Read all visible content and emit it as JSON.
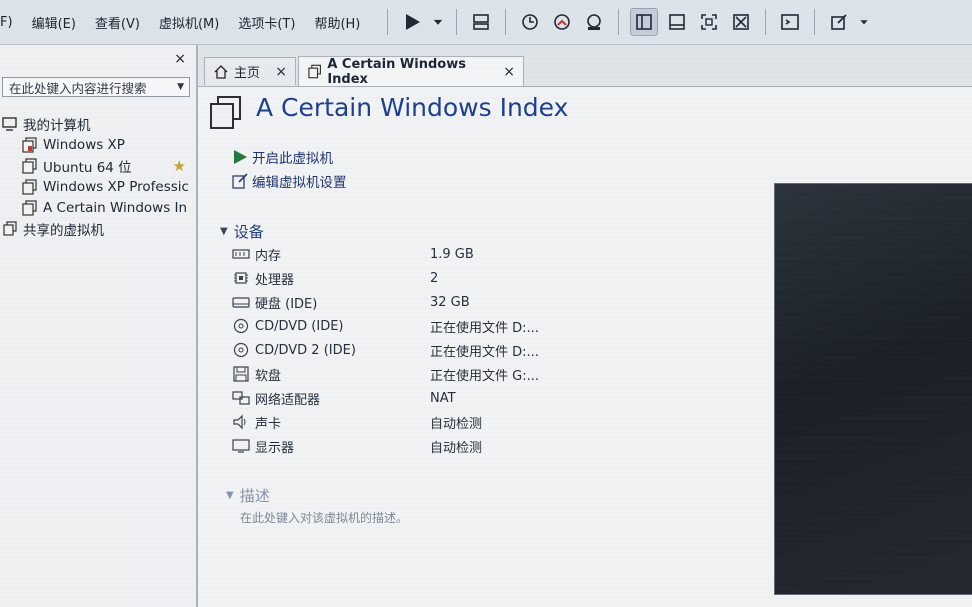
{
  "menu": [
    "F)",
    "编辑(E)",
    "查看(V)",
    "虚拟机(M)",
    "选项卡(T)",
    "帮助(H)"
  ],
  "toolbar": {
    "icons": [
      "play-icon",
      "dropdown-icon",
      "send-keys-icon",
      "snapshot-icon",
      "revert-snapshot-icon",
      "snapshot-manager-icon",
      "library-view-icon",
      "thumbnail-view-icon",
      "fullscreen-icon",
      "unity-icon",
      "console-icon",
      "settings-icon"
    ]
  },
  "library": {
    "close": "×",
    "search_placeholder": "在此处键入内容进行搜索",
    "tree": {
      "root": "我的计算机",
      "vms": [
        "Windows XP",
        "Ubuntu 64 位",
        "Windows XP Professic",
        "A Certain Windows In"
      ],
      "shared": "共享的虚拟机"
    }
  },
  "tabs": [
    {
      "label": "主页",
      "close": "×"
    },
    {
      "label": "A Certain Windows Index",
      "close": "×"
    }
  ],
  "vm": {
    "title": "A Certain Windows Index",
    "actions": {
      "power_on": "开启此虚拟机",
      "edit_settings": "编辑虚拟机设置"
    },
    "devices_header": "设备",
    "devices": [
      {
        "name": "内存",
        "value": "1.9 GB",
        "icon": "memory-icon"
      },
      {
        "name": "处理器",
        "value": "2",
        "icon": "cpu-icon"
      },
      {
        "name": "硬盘 (IDE)",
        "value": "32 GB",
        "icon": "hard-disk-icon"
      },
      {
        "name": "CD/DVD (IDE)",
        "value": "正在使用文件 D:...",
        "icon": "cd-dvd-icon"
      },
      {
        "name": "CD/DVD 2 (IDE)",
        "value": "正在使用文件 D:...",
        "icon": "cd-dvd-2-icon"
      },
      {
        "name": "软盘",
        "value": "正在使用文件 G:...",
        "icon": "floppy-icon"
      },
      {
        "name": "网络适配器",
        "value": "NAT",
        "icon": "network-adapter-icon"
      },
      {
        "name": "声卡",
        "value": "自动检测",
        "icon": "sound-card-icon"
      },
      {
        "name": "显示器",
        "value": "自动检测",
        "icon": "display-icon"
      }
    ],
    "description_header": "描述",
    "description_placeholder": "在此处键入对该虚拟机的描述。"
  }
}
